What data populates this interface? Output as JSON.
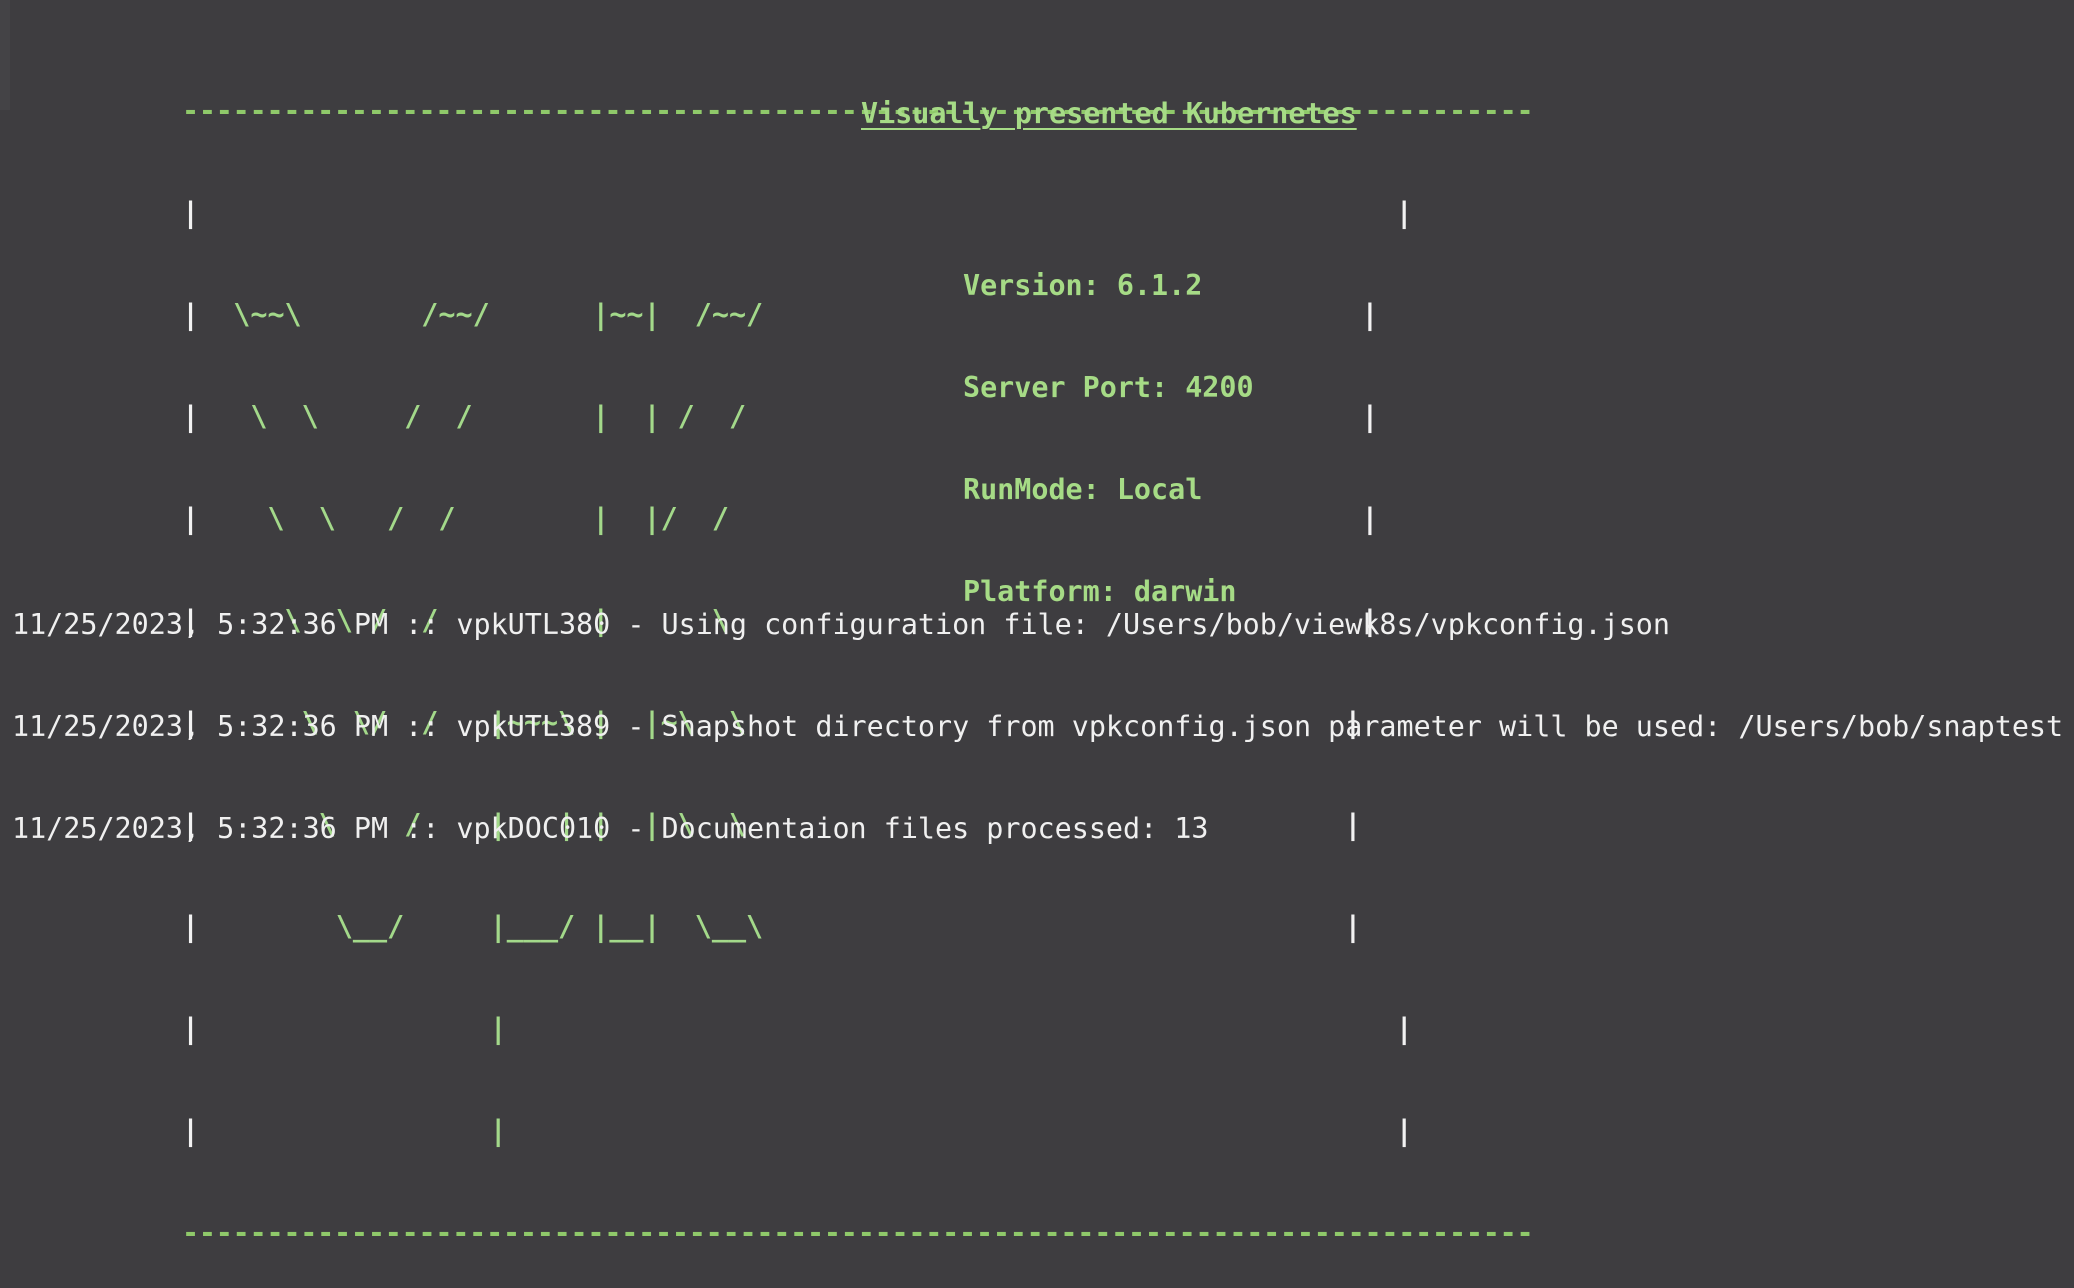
{
  "banner": {
    "rule": "--------------------------------------------------------------------------------",
    "art_rows": [
      {
        "frame_left": "|",
        "art": "                                                                      ",
        "frame_right": "|"
      },
      {
        "frame_left": "|",
        "art": "  \\~~\\       /~~/      |~~|  /~~/                                   ",
        "frame_right": "|"
      },
      {
        "frame_left": "|",
        "art": "   \\  \\     /  /       |  | /  /                                    ",
        "frame_right": "|"
      },
      {
        "frame_left": "|",
        "art": "    \\  \\   /  /        |  |/  /                                     ",
        "frame_right": "|"
      },
      {
        "frame_left": "|",
        "art": "     \\  \\ /  /         |      \\                                     ",
        "frame_right": "|"
      },
      {
        "frame_left": "|",
        "art": "      \\  \\/  /   |~~~\\ |  |~\\  \\                                   ",
        "frame_right": "|"
      },
      {
        "frame_left": "|",
        "art": "       \\    /    |   | |  | \\  \\                                   ",
        "frame_right": "|"
      },
      {
        "frame_left": "|",
        "art": "        \\__/     |___/ |__|  \\__\\                                  ",
        "frame_right": "|"
      },
      {
        "frame_left": "|",
        "art": "                 |                                                    ",
        "frame_right": "|"
      },
      {
        "frame_left": "|",
        "art": "                 |                                                    ",
        "frame_right": "|"
      }
    ],
    "tagline": "Visually presented Kubernetes",
    "version": "Version: 6.1.2",
    "server_port": "Server Port: 4200",
    "run_mode": "RunMode: Local",
    "platform": "Platform: darwin"
  },
  "log": [
    "11/25/2023, 5:32:36 PM :: vpkUTL380 - Using configuration file: /Users/bob/viewk8s/vpkconfig.json",
    "11/25/2023, 5:32:36 PM :: vpkUTL389 - Snapshot directory from vpkconfig.json parameter will be used: /Users/bob/snaptest",
    "11/25/2023, 5:32:36 PM :: vpkDOC010 - Documentaion files processed: 13"
  ]
}
